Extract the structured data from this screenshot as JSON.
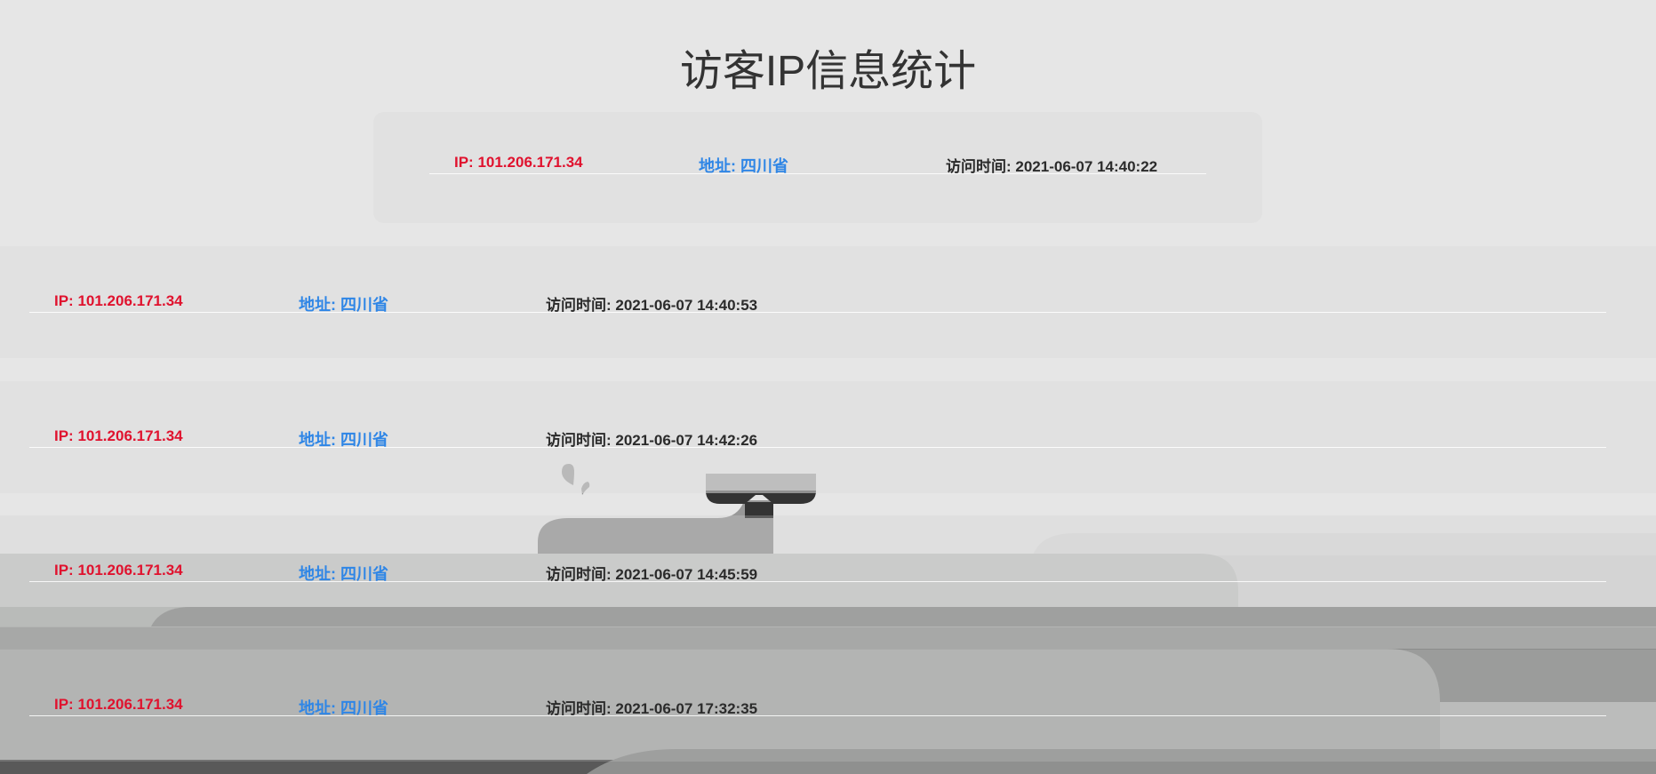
{
  "page": {
    "title": "访客IP信息统计"
  },
  "records": [
    {
      "ip": "IP: 101.206.171.34",
      "address": "地址: 四川省",
      "visit_time": "访问时间: 2021-06-07 14:40:22"
    },
    {
      "ip": "IP: 101.206.171.34",
      "address": "地址: 四川省",
      "visit_time": "访问时间: 2021-06-07 14:40:53"
    },
    {
      "ip": "IP: 101.206.171.34",
      "address": "地址: 四川省",
      "visit_time": "访问时间: 2021-06-07 14:42:26"
    },
    {
      "ip": "IP: 101.206.171.34",
      "address": "地址: 四川省",
      "visit_time": "访问时间: 2021-06-07 14:45:59"
    },
    {
      "ip": "IP: 101.206.171.34",
      "address": "地址: 四川省",
      "visit_time": "访问时间: 2021-06-07 17:32:35"
    }
  ],
  "colors": {
    "ip": "#e0122e",
    "address": "#2f86e6",
    "time": "#2b2b2b",
    "title": "#333333",
    "background": "#e6e6e6"
  },
  "decoration": {
    "icon": "whale-icon"
  }
}
